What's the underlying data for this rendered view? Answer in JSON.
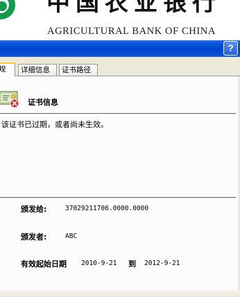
{
  "bank": {
    "name_cn": "中国农业银行",
    "name_en": "AGRICULTURAL BANK OF CHINA"
  },
  "titlebar": {
    "help_label": "?"
  },
  "tabs": [
    {
      "label": "规"
    },
    {
      "label": "详细信息"
    },
    {
      "label": "证书路径"
    }
  ],
  "cert_info": {
    "title": "证书信息",
    "status": "该证书已过期，或者尚未生效。",
    "issued_to_label": "颁发给:",
    "issued_to": "37029211706.0000.0000",
    "issued_by_label": "颁发者:",
    "issued_by": "ABC",
    "valid_label": "有效起始日期",
    "valid_from": "2010-9-21",
    "valid_to_word": "到",
    "valid_to": "2012-9-21"
  },
  "icons": {
    "certificate": "certificate-invalid-icon",
    "logo": "abc-logo-icon"
  },
  "colors": {
    "title_bar": "#0046d0",
    "logo_green": "#119a4b",
    "error_red": "#d8281c",
    "tab_highlight": "#ffc83c"
  }
}
